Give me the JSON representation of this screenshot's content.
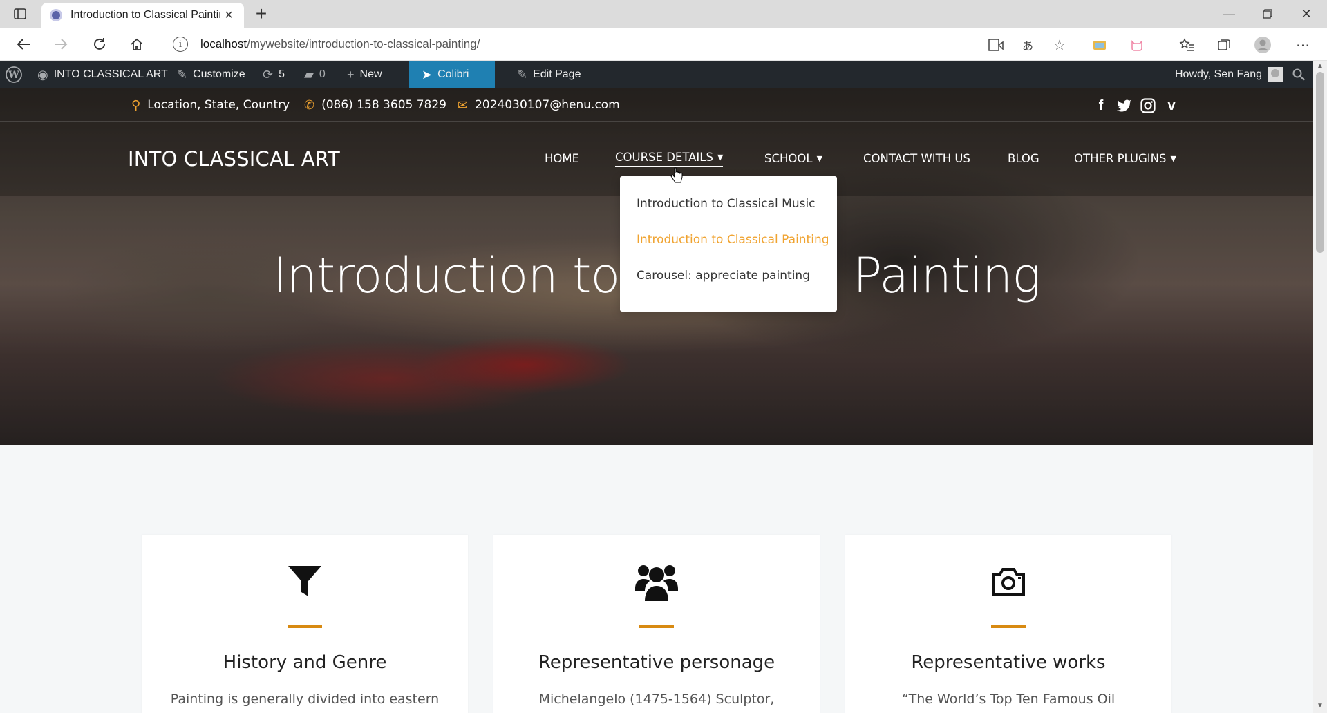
{
  "browser": {
    "tab_title": "Introduction to Classical Painting",
    "url_host": "localhost",
    "url_path": "/mywebsite/introduction-to-classical-painting/"
  },
  "wpbar": {
    "site_name": "INTO CLASSICAL ART",
    "customize": "Customize",
    "updates_count": "5",
    "comments_count": "0",
    "new_label": "New",
    "colibri": "Colibri",
    "edit_page": "Edit Page",
    "howdy": "Howdy, Sen Fang"
  },
  "topbar": {
    "location": "Location, State, Country",
    "phone": "(086) 158 3605 7829",
    "email": "2024030107@henu.com"
  },
  "nav": {
    "logo": "INTO CLASSICAL ART",
    "items": [
      "HOME",
      "COURSE DETAILS",
      "SCHOOL",
      "CONTACT WITH US",
      "BLOG",
      "OTHER PLUGINS"
    ]
  },
  "dropdown": {
    "items": [
      "Introduction to Classical Music",
      "Introduction to Classical Painting",
      "Carousel: appreciate painting"
    ]
  },
  "hero": {
    "title": "Introduction to Classical Painting"
  },
  "cards": [
    {
      "title": "History and Genre",
      "text": "Painting is generally divided into eastern",
      "icon": "filter-icon"
    },
    {
      "title": "Representative personage",
      "text": "Michelangelo (1475-1564) Sculptor,",
      "icon": "users-icon"
    },
    {
      "title": "Representative works",
      "text": "“The World’s Top Ten Famous Oil",
      "icon": "camera-icon"
    }
  ],
  "colors": {
    "accent": "#f0a330",
    "card_bar": "#d88a12",
    "wpbar": "#23282d",
    "colibri": "#1f80b2"
  }
}
